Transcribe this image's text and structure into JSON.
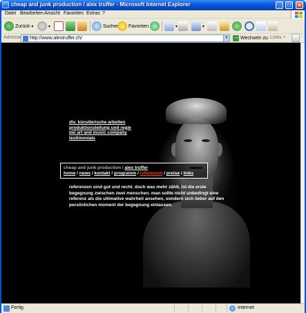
{
  "window": {
    "title": "cheap and junk production / alex truffer - Microsoft Internet Explorer"
  },
  "menu": [
    "Datei",
    "Bearbeiten",
    "Ansicht",
    "Favoriten",
    "Extras",
    "?"
  ],
  "toolbar": {
    "back": "Zurück",
    "search": "Suchen",
    "favorites": "Favoriten"
  },
  "address": {
    "label": "Adresse",
    "url": "http://www.alextruffer.ch/",
    "go": "Wechseln zu",
    "links": "Links"
  },
  "page": {
    "side_links": [
      "div. künstlerische arbeiten",
      "produktionsleitung und regie",
      "bei art and music company",
      "testimonials"
    ],
    "nav_title_prefix": "cheap and junk production / ",
    "nav_title_name": "alex truffer",
    "nav": [
      "home",
      "news",
      "kontakt",
      "programm",
      "referenzen",
      "preise",
      "links"
    ],
    "nav_active": "referenzen",
    "body": "referenzen sind gut und recht. doch was mehr zählt, ist die erste begegnung zwischen zwei menschen. man sollte nicht unbedingt eine referenz als die ultimative wahrheit ansehen, sondern sich lieber auf den persönlichen moment der begegnung einlassen."
  },
  "status": {
    "text": "Fertig",
    "zone": "Internet"
  },
  "colors": {
    "accent_active": "#ff3b00",
    "title_grey": "#9bb6c8",
    "page_bg": "#000000"
  }
}
